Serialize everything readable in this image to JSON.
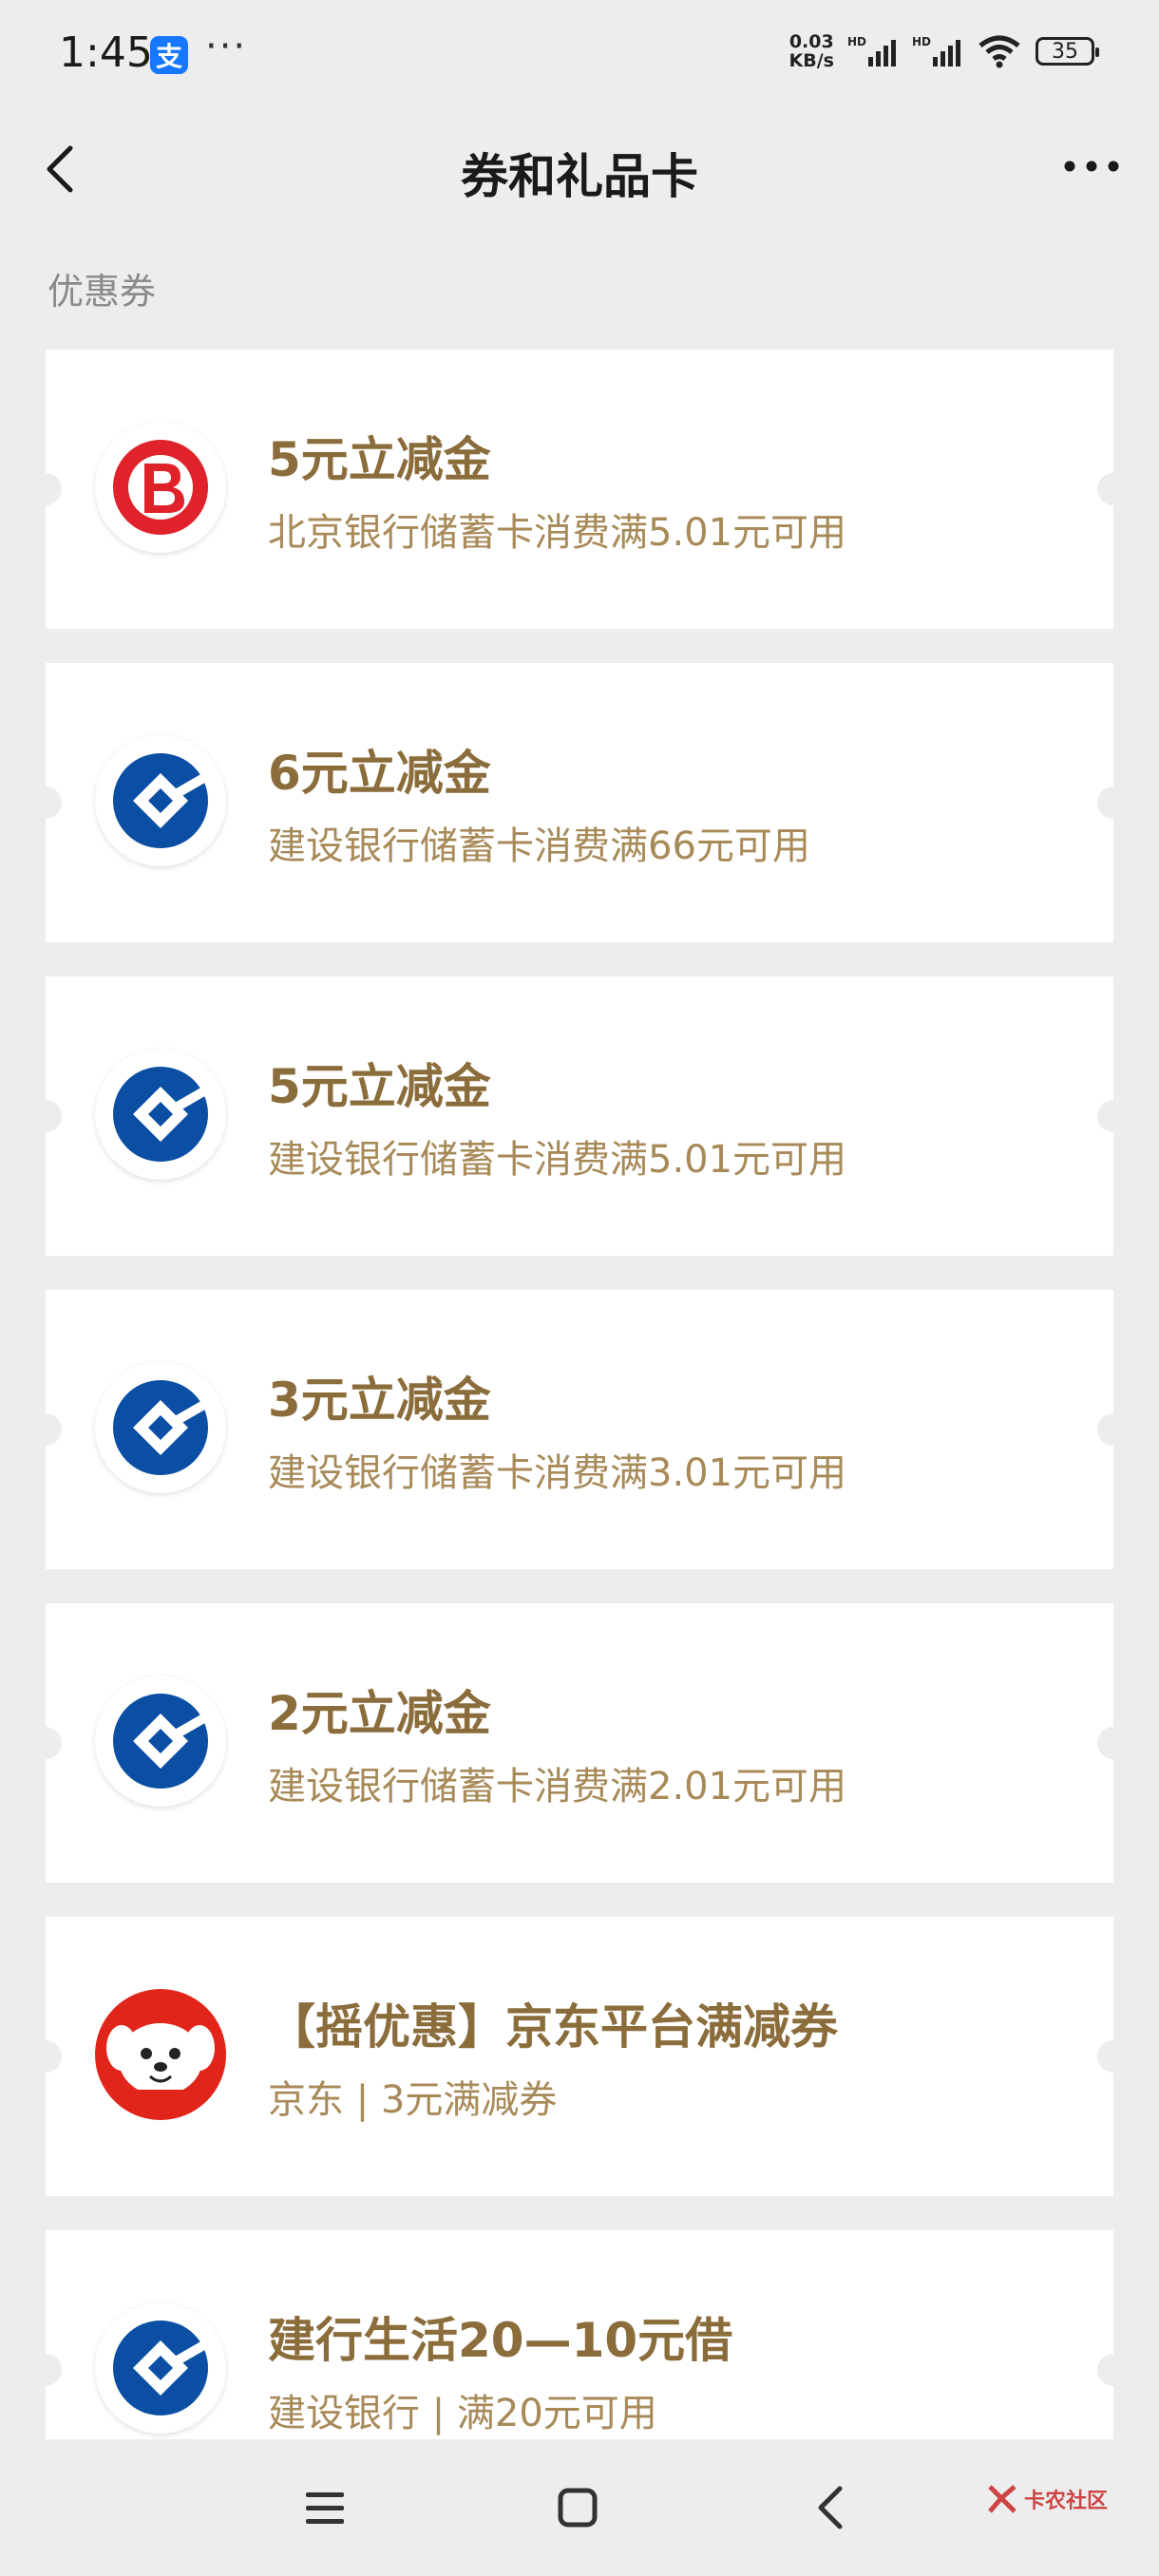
{
  "status": {
    "time": "1:45",
    "dots": "···",
    "net_speed_value": "0.03",
    "net_speed_unit": "KB/s",
    "battery": "35"
  },
  "header": {
    "title": "券和礼品卡"
  },
  "section": {
    "label": "优惠券"
  },
  "coupons": [
    {
      "logo": "bank-of-beijing-logo",
      "title": "5元立减金",
      "desc": "北京银行储蓄卡消费满5.01元可用"
    },
    {
      "logo": "ccb-logo",
      "title": "6元立减金",
      "desc": "建设银行储蓄卡消费满66元可用"
    },
    {
      "logo": "ccb-logo",
      "title": "5元立减金",
      "desc": "建设银行储蓄卡消费满5.01元可用"
    },
    {
      "logo": "ccb-logo",
      "title": "3元立减金",
      "desc": "建设银行储蓄卡消费满3.01元可用"
    },
    {
      "logo": "ccb-logo",
      "title": "2元立减金",
      "desc": "建设银行储蓄卡消费满2.01元可用"
    },
    {
      "logo": "jd-joy-logo",
      "title": "【摇优惠】京东平台满减券",
      "desc": "京东 | 3元满减券"
    },
    {
      "logo": "ccb-logo",
      "title": "建行生活20—10元借",
      "desc": "建设银行 | 满20元可用"
    }
  ],
  "watermark": {
    "text": "卡农社区"
  },
  "colors": {
    "coupon_title": "#8b6d3c",
    "coupon_desc": "#a88a58",
    "ccb_blue": "#0a4fa3",
    "bob_red": "#e0232b",
    "jd_red": "#e1251b"
  }
}
